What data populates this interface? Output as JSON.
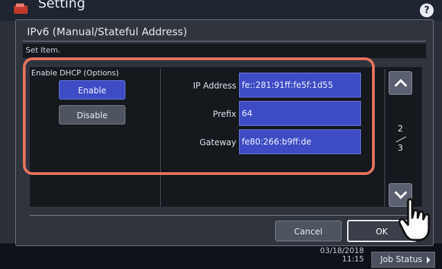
{
  "app": {
    "title": "Setting",
    "help_label": "?"
  },
  "footer": {
    "date": "03/18/2018",
    "time": "11:15",
    "job_status": "Job Status"
  },
  "dialog": {
    "title": "IPv6 (Manual/Stateful Address)",
    "subheading": "Set Item.",
    "dhcp": {
      "label": "Enable DHCP (Options)",
      "enable_label": "Enable",
      "disable_label": "Disable",
      "selected": "Enable"
    },
    "fields": [
      {
        "label": "IP Address",
        "value": "fe::281:91ff:fe5f:1d55"
      },
      {
        "label": "Prefix",
        "value": "64"
      },
      {
        "label": "Gateway",
        "value": "fe80:266:b9ff:de"
      }
    ],
    "page": {
      "current": "2",
      "total": "3"
    },
    "cancel_label": "Cancel",
    "ok_label": "OK"
  },
  "colors": {
    "accent_blue": "#3d4cc4",
    "highlight": "#e8735e",
    "dialog_bg": "#2f343d"
  },
  "icons": [
    "logo-icon",
    "help-icon",
    "chevron-up-icon",
    "chevron-down-icon",
    "pointing-hand-icon",
    "play-arrow-icon"
  ]
}
